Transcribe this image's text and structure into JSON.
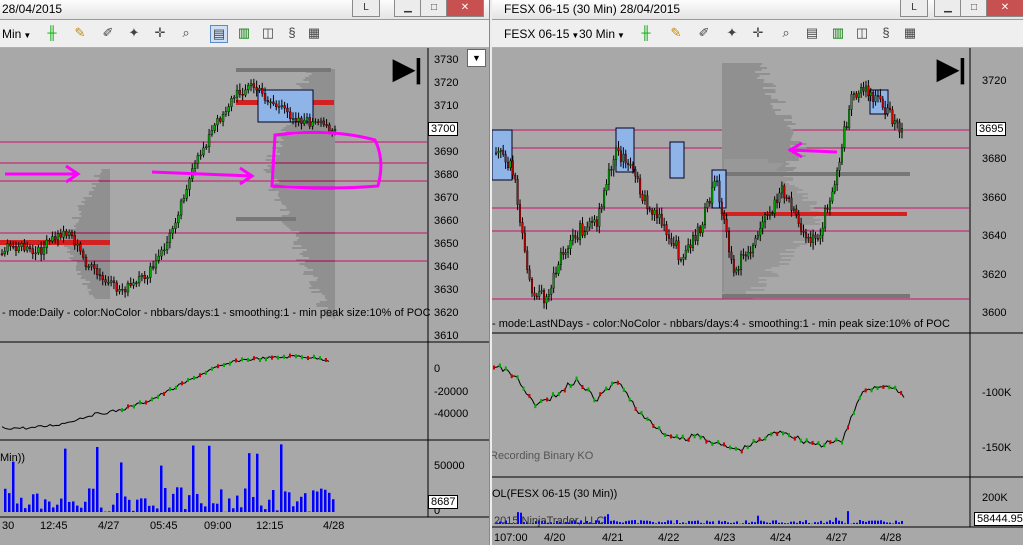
{
  "left": {
    "title": "28/04/2015",
    "title_btn": "L",
    "interval": "Min",
    "study_label": "- mode:Daily - color:NoColor - nbbars/days:1 - smoothing:1 - min peak size:10% of POC",
    "price_ticks": [
      "3730",
      "3720",
      "3710",
      "3700",
      "3690",
      "3680",
      "3670",
      "3660",
      "3650",
      "3640",
      "3630",
      "3620",
      "3610"
    ],
    "current_price": "3700",
    "osc_ticks": [
      "0",
      "-20000",
      "-40000"
    ],
    "vol_ticks": [
      "50000",
      "0"
    ],
    "vol_label": "Min))",
    "vol_last": "8687",
    "time_ticks": [
      "30",
      "12:45",
      "4/27",
      "05:45",
      "09:00",
      "12:15",
      "4/28"
    ]
  },
  "right": {
    "title": "FESX 06-15 (30 Min)  28/04/2015",
    "title_btn": "L",
    "instrument": "FESX 06-15",
    "interval": "30 Min",
    "study_label": "- mode:LastNDays - color:NoColor - nbbars/days:4 - smoothing:1 - min peak size:10% of POC",
    "price_ticks": [
      "3720",
      "3700",
      "3680",
      "3660",
      "3640",
      "3620",
      "3600"
    ],
    "current_price": "3695",
    "osc_ticks": [
      "-100K",
      "-150K"
    ],
    "osc_watermark": "Recording Binary KO",
    "vol_label": "OL(FESX 06-15 (30 Min))",
    "vol_ticks": [
      "200K",
      "0"
    ],
    "vol_last": "58444.95",
    "copyright": "2015 NinjaTrader, LLC",
    "time_ticks": [
      "107:00",
      "4/20",
      "4/21",
      "4/22",
      "4/23",
      "4/24",
      "4/27",
      "4/28"
    ]
  },
  "colors": {
    "background": "#a8a8a8",
    "up_candle": "#00aa00",
    "down_candle": "#cc0000",
    "poc_line": "#d42020",
    "level_line": "#c8106a",
    "annotation": "#ff00ff",
    "volume_bar": "#0000ff",
    "box_fill": "#8fb4e8"
  },
  "icons": [
    "candlestick-icon",
    "pencil-icon",
    "crosshair-icon",
    "zoom-icon",
    "properties-icon",
    "chart-style-icon",
    "data-box-icon"
  ]
}
